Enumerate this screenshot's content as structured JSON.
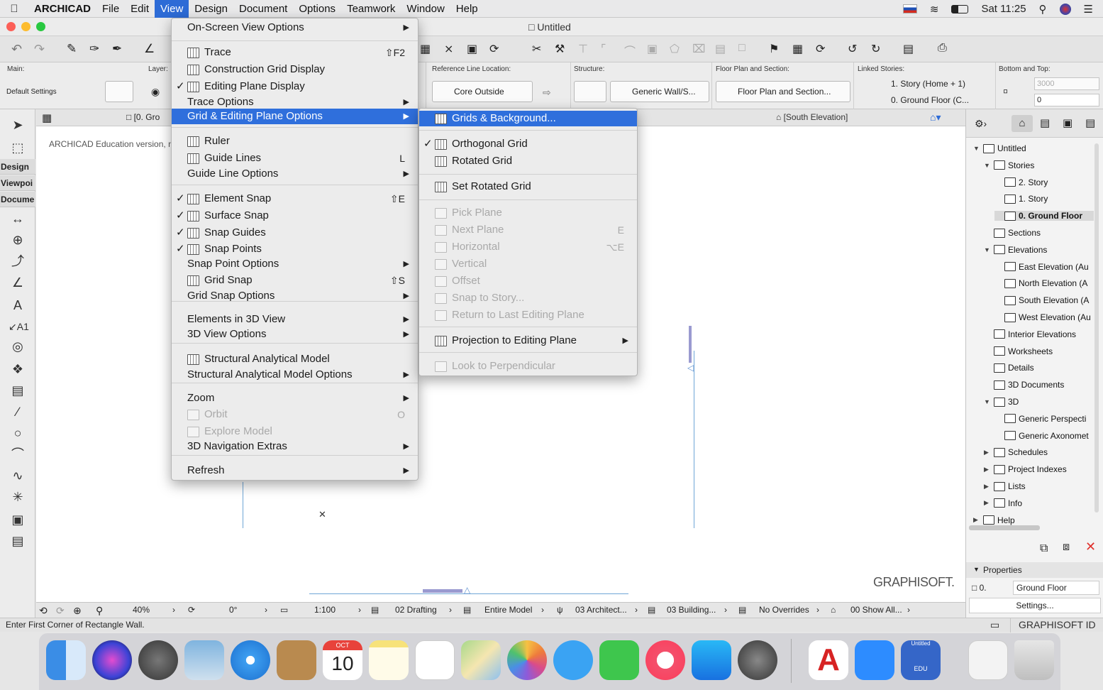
{
  "menubar": {
    "app": "ARCHICAD",
    "items": [
      "File",
      "Edit",
      "View",
      "Design",
      "Document",
      "Options",
      "Teamwork",
      "Window",
      "Help"
    ],
    "active": "View",
    "clock": "Sat 11:25"
  },
  "window": {
    "title": "Untitled"
  },
  "infobox": {
    "main_label": "Main:",
    "default_settings": "Default Settings",
    "layer_label": "Layer:",
    "refline_label": "Reference Line Location:",
    "refline_value": "Core Outside",
    "structure_label": "Structure:",
    "structure_value": "Generic Wall/S...",
    "floorplan_label": "Floor Plan and Section:",
    "floorplan_value": "Floor Plan and Section...",
    "linked_label": "Linked Stories:",
    "linked_top": "1. Story (Home + 1)",
    "linked_bottom": "0. Ground Floor (C...",
    "bottomtop_label": "Bottom and Top:",
    "top_value": "3000",
    "bottom_value": "0"
  },
  "toolbox": {
    "design": "Design",
    "viewpoint": "Viewpoi",
    "document": "Docume"
  },
  "tabs": {
    "ground": "[0. Gro",
    "south": "[South Elevation]"
  },
  "canvas": {
    "watermark_text": "ARCHICAD Education version, n",
    "brand": "GRAPHISOFT."
  },
  "view_menu": [
    {
      "label": "On-Screen View Options",
      "submenu": true
    },
    {
      "label": "Trace",
      "icon": true,
      "shortcut": "⇧F2"
    },
    {
      "label": "Construction Grid Display",
      "icon": true
    },
    {
      "label": "Editing Plane Display",
      "icon": true,
      "checked": true
    },
    {
      "label": "Trace Options",
      "submenu": true
    },
    {
      "label": "Grid & Editing Plane Options",
      "submenu": true,
      "highlight": true
    },
    {
      "label": "Ruler",
      "icon": true
    },
    {
      "label": "Guide Lines",
      "icon": true,
      "shortcut": "L"
    },
    {
      "label": "Guide Line Options",
      "submenu": true
    },
    {
      "label": "Element Snap",
      "icon": true,
      "checked": true,
      "shortcut": "⇧E"
    },
    {
      "label": "Surface Snap",
      "icon": true,
      "checked": true
    },
    {
      "label": "Snap Guides",
      "icon": true,
      "checked": true
    },
    {
      "label": "Snap Points",
      "icon": true,
      "checked": true
    },
    {
      "label": "Snap Point Options",
      "submenu": true
    },
    {
      "label": "Grid Snap",
      "icon": true,
      "shortcut": "⇧S"
    },
    {
      "label": "Grid Snap Options",
      "submenu": true
    },
    {
      "label": "Elements in 3D View",
      "submenu": true
    },
    {
      "label": "3D View Options",
      "submenu": true
    },
    {
      "label": "Structural Analytical Model",
      "icon": true
    },
    {
      "label": "Structural Analytical Model Options",
      "submenu": true
    },
    {
      "label": "Zoom",
      "submenu": true
    },
    {
      "label": "Orbit",
      "icon": true,
      "shortcut": "O",
      "disabled": true
    },
    {
      "label": "Explore Model",
      "icon": true,
      "disabled": true
    },
    {
      "label": "3D Navigation Extras",
      "submenu": true
    },
    {
      "label": "Refresh",
      "submenu": true
    }
  ],
  "grid_submenu": [
    {
      "label": "Grids & Background...",
      "icon": true,
      "highlight": true
    },
    {
      "label": "Orthogonal Grid",
      "icon": true,
      "checked": true
    },
    {
      "label": "Rotated Grid",
      "icon": true
    },
    {
      "label": "Set Rotated Grid",
      "icon": true
    },
    {
      "label": "Pick Plane",
      "icon": true,
      "disabled": true
    },
    {
      "label": "Next Plane",
      "icon": true,
      "shortcut": "E",
      "disabled": true
    },
    {
      "label": "Horizontal",
      "icon": true,
      "shortcut": "⌥E",
      "disabled": true
    },
    {
      "label": "Vertical",
      "icon": true,
      "disabled": true
    },
    {
      "label": "Offset",
      "icon": true,
      "disabled": true
    },
    {
      "label": "Snap to Story...",
      "icon": true,
      "disabled": true
    },
    {
      "label": "Return to Last Editing Plane",
      "icon": true,
      "disabled": true
    },
    {
      "label": "Projection to Editing Plane",
      "icon": true,
      "submenu": true
    },
    {
      "label": "Look to Perpendicular",
      "icon": true,
      "disabled": true
    }
  ],
  "navigator": {
    "items": [
      {
        "label": "Untitled",
        "level": 0,
        "open": true
      },
      {
        "label": "Stories",
        "level": 1,
        "open": true
      },
      {
        "label": "2. Story",
        "level": 2
      },
      {
        "label": "1. Story",
        "level": 2
      },
      {
        "label": "0. Ground Floor",
        "level": 2,
        "selected": true
      },
      {
        "label": "Sections",
        "level": 1
      },
      {
        "label": "Elevations",
        "level": 1,
        "open": true
      },
      {
        "label": "East Elevation (Au",
        "level": 2
      },
      {
        "label": "North Elevation (A",
        "level": 2
      },
      {
        "label": "South Elevation (A",
        "level": 2
      },
      {
        "label": "West Elevation (Au",
        "level": 2
      },
      {
        "label": "Interior Elevations",
        "level": 1
      },
      {
        "label": "Worksheets",
        "level": 1
      },
      {
        "label": "Details",
        "level": 1
      },
      {
        "label": "3D Documents",
        "level": 1
      },
      {
        "label": "3D",
        "level": 1,
        "open": true
      },
      {
        "label": "Generic Perspecti",
        "level": 2
      },
      {
        "label": "Generic Axonomet",
        "level": 2
      },
      {
        "label": "Schedules",
        "level": 1,
        "closed": true
      },
      {
        "label": "Project Indexes",
        "level": 1,
        "closed": true
      },
      {
        "label": "Lists",
        "level": 1,
        "closed": true
      },
      {
        "label": "Info",
        "level": 1,
        "closed": true
      },
      {
        "label": "Help",
        "level": 0,
        "closed": true
      }
    ],
    "properties_label": "Properties",
    "prop_id": "0.",
    "prop_name": "Ground Floor",
    "settings": "Settings..."
  },
  "bottombar": {
    "zoom": "40%",
    "angle": "0°",
    "scale": "1:100",
    "layer_combo": "02 Drafting",
    "model": "Entire Model",
    "pen": "03 Architect...",
    "mvo": "03 Building...",
    "overrides": "No Overrides",
    "renovation": "00 Show All..."
  },
  "status": {
    "text": "Enter First Corner of Rectangle Wall.",
    "right": "GRAPHISOFT ID"
  },
  "dock": {
    "calendar_month": "OCT",
    "calendar_day": "10",
    "zoom_label": "Untitled",
    "edu": "EDU"
  }
}
